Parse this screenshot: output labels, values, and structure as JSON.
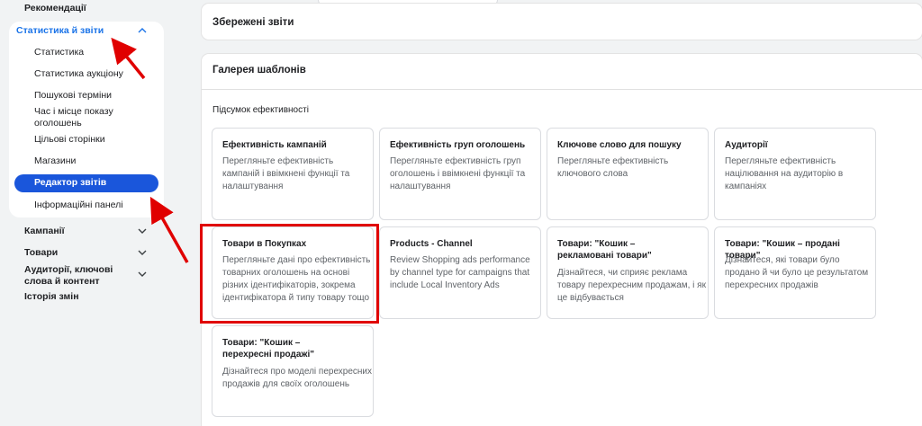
{
  "sidebar": {
    "top_item": "Рекомендації",
    "section": {
      "label": "Статистика й звіти",
      "sub_items": [
        "Статистика",
        "Статистика аукціону",
        "Пошукові терміни",
        "Час і місце показу оголошень",
        "Цільові сторінки",
        "Магазини"
      ],
      "active_item": "Редактор звітів",
      "after_active": "Інформаційні панелі"
    },
    "items": [
      "Кампанії",
      "Товари",
      "Аудиторії, ключові слова й контент",
      "Історія змін"
    ]
  },
  "main": {
    "saved_reports_title": "Збережені звіти",
    "gallery_title": "Галерея шаблонів",
    "summary_heading": "Підсумок ефективності",
    "cards": [
      {
        "title": "Ефективність кампаній",
        "desc": "Перегляньте ефективність кампаній і ввімкнені функції та налаштування"
      },
      {
        "title": "Ефективність груп оголошень",
        "desc": "Перегляньте ефективність груп оголошень і ввімкнені функції та налаштування"
      },
      {
        "title": "Ключове слово для пошуку",
        "desc": "Перегляньте ефективність ключового слова"
      },
      {
        "title": "Аудиторії",
        "desc": "Перегляньте ефективність націлювання на аудиторію в кампаніях"
      },
      {
        "title": "Товари в Покупках",
        "desc": "Перегляньте дані про ефективність товарних оголошень на основі різних ідентифікаторів, зокрема ідентифікатора й типу товару тощо"
      },
      {
        "title": "Products - Channel",
        "desc": "Review Shopping ads performance by channel type for campaigns that include Local Inventory Ads"
      },
      {
        "title": "Товари: \"Кошик – рекламовані товари\"",
        "desc": "Дізнайтеся, чи сприяє реклама товару перехресним продажам, і як це відбувається"
      },
      {
        "title": "Товари: \"Кошик – продані товари\"",
        "desc": "Дізнайтеся, які товари було продано й чи було це результатом перехресних продажів"
      },
      {
        "title": "Товари: \"Кошик – перехресні продажі\"",
        "desc": "Дізнайтеся про моделі перехресних продажів для своїх оголошень"
      }
    ]
  },
  "colors": {
    "accent": "#1a73e8",
    "active_pill": "#1a56db",
    "highlight": "#e00000"
  },
  "icons": [
    "chevron-up-icon",
    "chevron-down-icon",
    "annotation-arrow"
  ]
}
